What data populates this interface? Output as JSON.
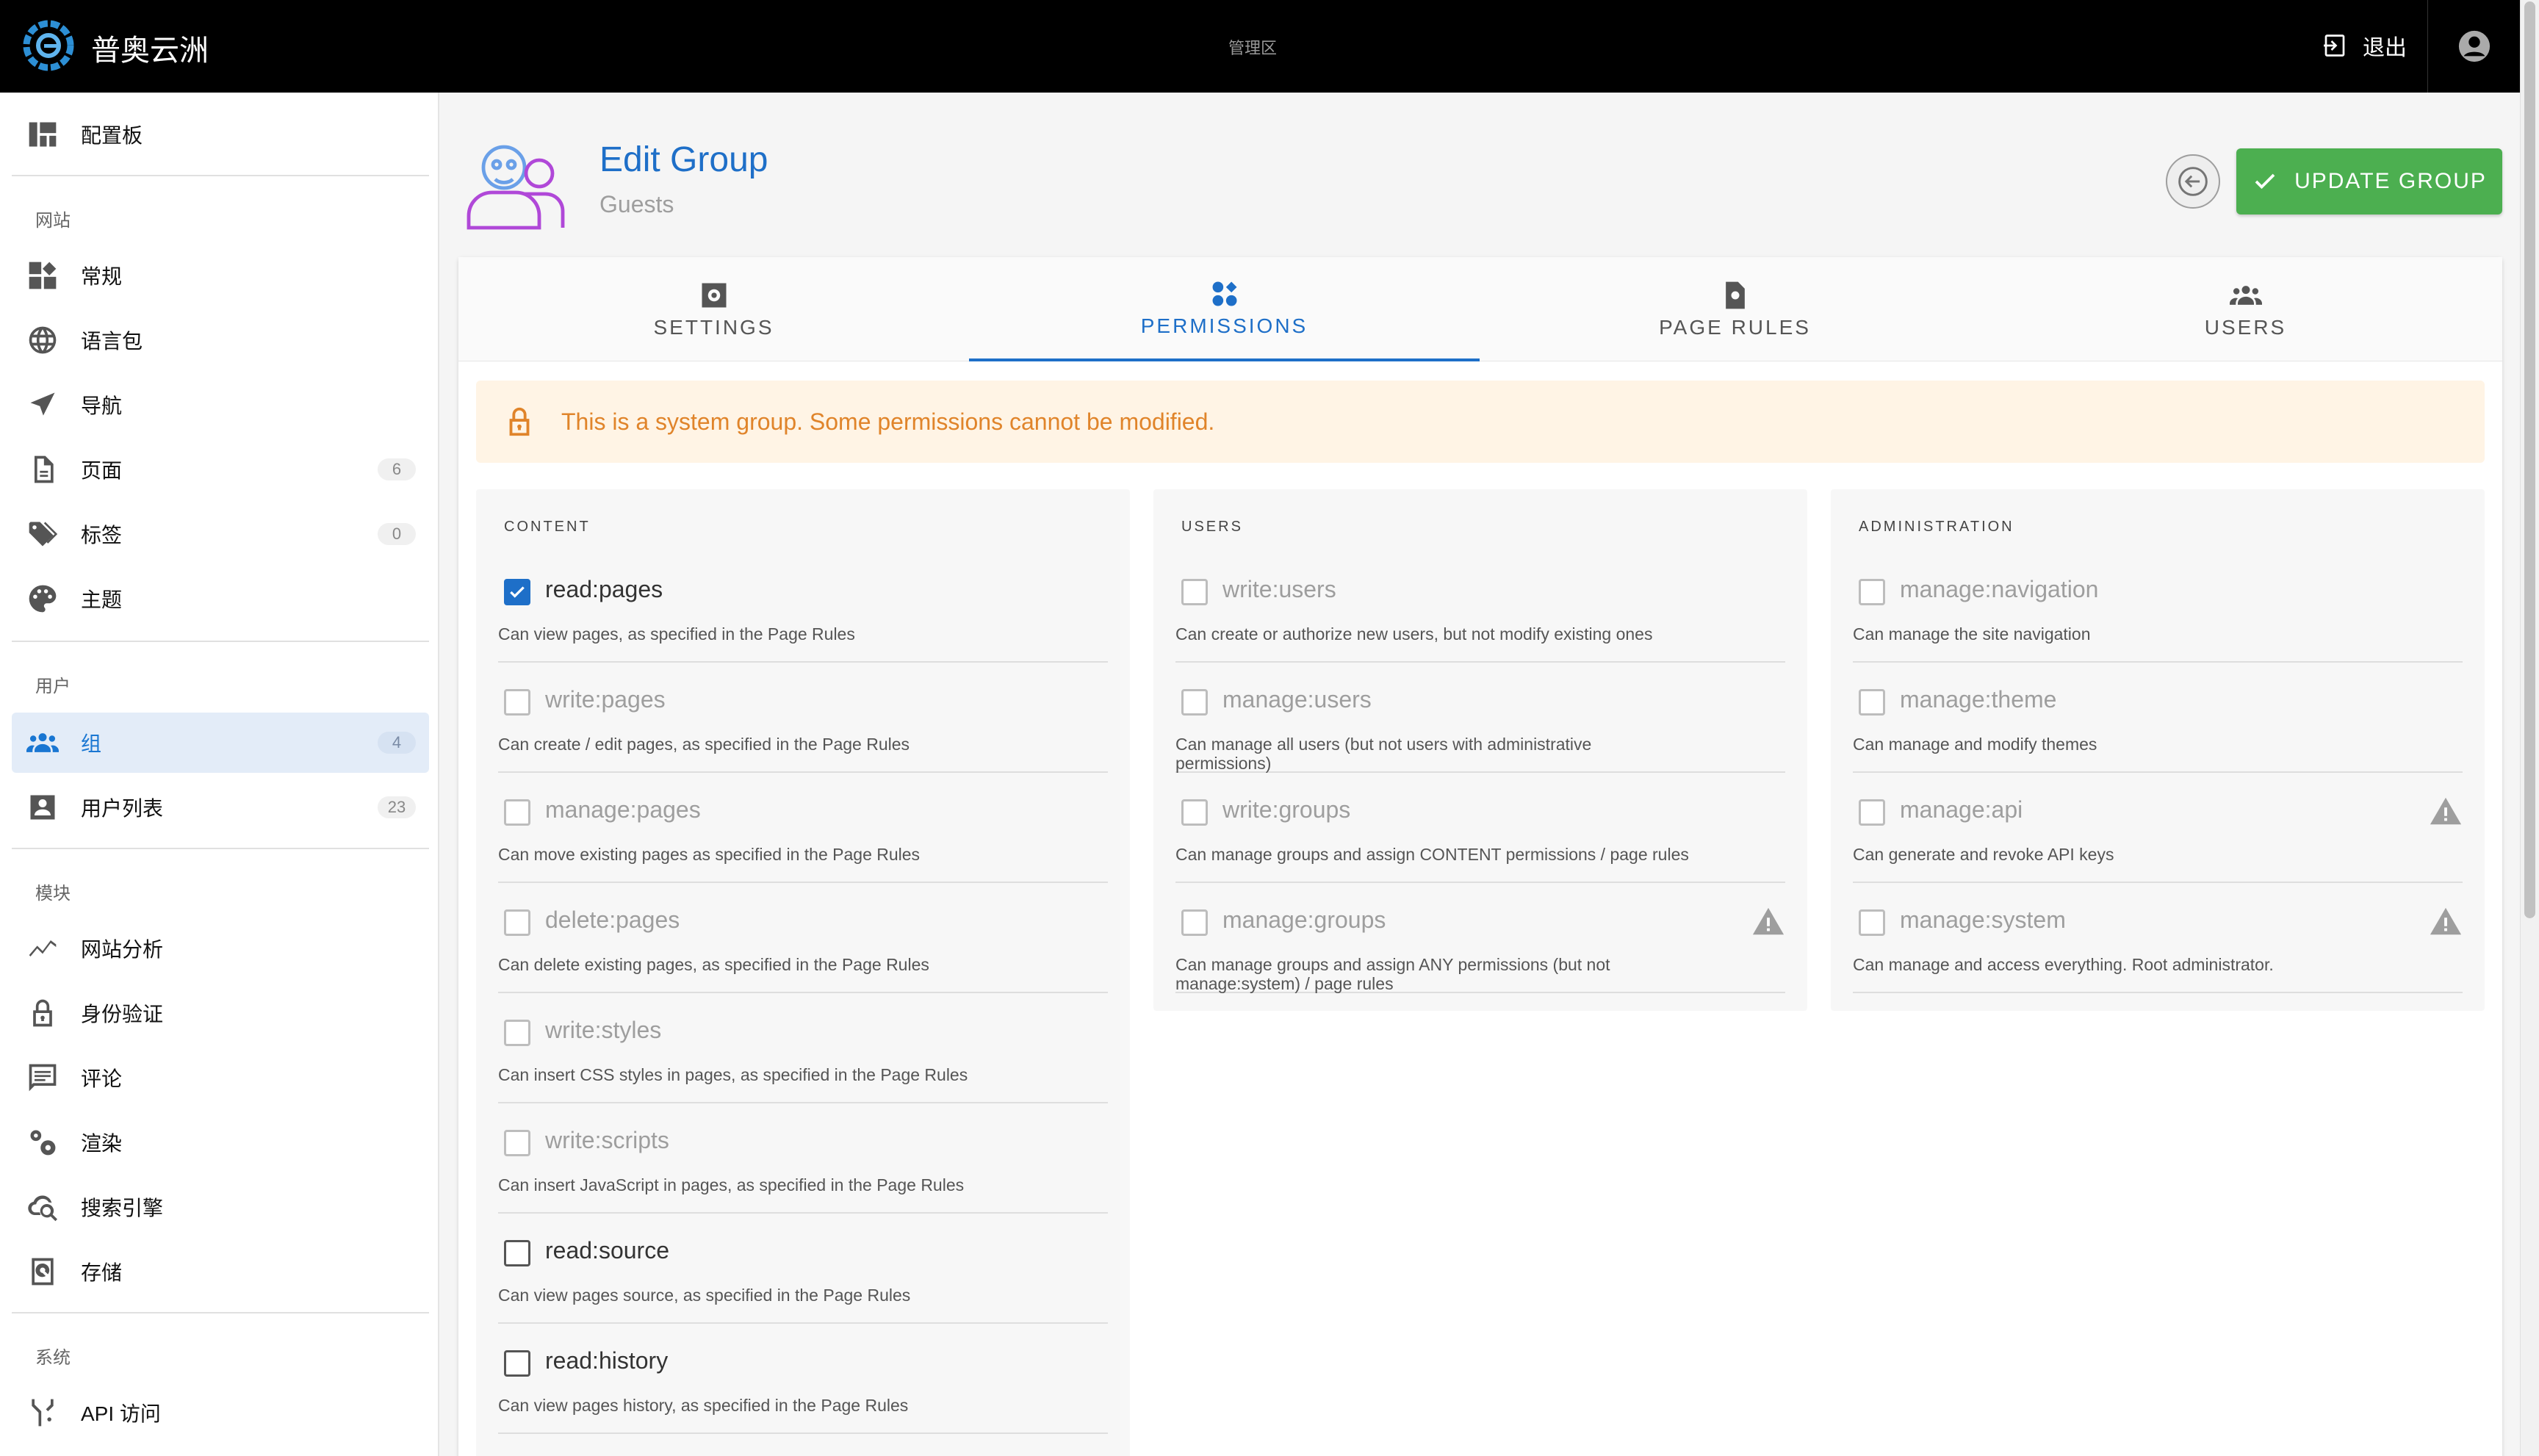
{
  "header": {
    "brand": "普奥云洲",
    "center_label": "管理区",
    "logout_label": "退出"
  },
  "sidebar": {
    "dashboard": "配置板",
    "sections": {
      "site": "网站",
      "users": "用户",
      "modules": "模块",
      "system": "系统"
    },
    "site_items": [
      {
        "label": "常规",
        "icon": "general-icon"
      },
      {
        "label": "语言包",
        "icon": "globe-icon"
      },
      {
        "label": "导航",
        "icon": "navigation-icon"
      },
      {
        "label": "页面",
        "icon": "page-icon",
        "count": "6"
      },
      {
        "label": "标签",
        "icon": "tag-icon",
        "count": "0"
      },
      {
        "label": "主题",
        "icon": "palette-icon"
      }
    ],
    "user_items": [
      {
        "label": "组",
        "icon": "group-icon",
        "count": "4"
      },
      {
        "label": "用户列表",
        "icon": "user-list-icon",
        "count": "23"
      }
    ],
    "module_items": [
      {
        "label": "网站分析",
        "icon": "analytics-icon"
      },
      {
        "label": "身份验证",
        "icon": "lock-icon"
      },
      {
        "label": "评论",
        "icon": "comment-icon"
      },
      {
        "label": "渲染",
        "icon": "gears-icon"
      },
      {
        "label": "搜索引擎",
        "icon": "search-cloud-icon"
      },
      {
        "label": "存储",
        "icon": "storage-icon"
      }
    ],
    "system_items": [
      {
        "label": "API 访问",
        "icon": "api-icon"
      }
    ]
  },
  "page": {
    "title": "Edit Group",
    "subtitle": "Guests",
    "update_label": "UPDATE GROUP"
  },
  "tabs": [
    {
      "label": "SETTINGS",
      "icon": "settings-icon"
    },
    {
      "label": "PERMISSIONS",
      "icon": "permissions-icon",
      "active": true
    },
    {
      "label": "PAGE RULES",
      "icon": "page-rules-icon"
    },
    {
      "label": "USERS",
      "icon": "users-icon"
    }
  ],
  "alert": {
    "text": "This is a system group. Some permissions cannot be modified.",
    "color": "#e0842a"
  },
  "columns": [
    {
      "title": "CONTENT",
      "permissions": [
        {
          "name": "read:pages",
          "desc": "Can view pages, as specified in the Page Rules",
          "checked": true,
          "enabled": true
        },
        {
          "name": "write:pages",
          "desc": "Can create / edit pages, as specified in the Page Rules",
          "checked": false,
          "enabled": false
        },
        {
          "name": "manage:pages",
          "desc": "Can move existing pages as specified in the Page Rules",
          "checked": false,
          "enabled": false
        },
        {
          "name": "delete:pages",
          "desc": "Can delete existing pages, as specified in the Page Rules",
          "checked": false,
          "enabled": false
        },
        {
          "name": "write:styles",
          "desc": "Can insert CSS styles in pages, as specified in the Page Rules",
          "checked": false,
          "enabled": false
        },
        {
          "name": "write:scripts",
          "desc": "Can insert JavaScript in pages, as specified in the Page Rules",
          "checked": false,
          "enabled": false
        },
        {
          "name": "read:source",
          "desc": "Can view pages source, as specified in the Page Rules",
          "checked": false,
          "enabled": true
        },
        {
          "name": "read:history",
          "desc": "Can view pages history, as specified in the Page Rules",
          "checked": false,
          "enabled": true
        }
      ]
    },
    {
      "title": "USERS",
      "permissions": [
        {
          "name": "write:users",
          "desc": "Can create or authorize new users, but not modify existing ones",
          "checked": false,
          "enabled": false
        },
        {
          "name": "manage:users",
          "desc": "Can manage all users (but not users with administrative permissions)",
          "checked": false,
          "enabled": false
        },
        {
          "name": "write:groups",
          "desc": "Can manage groups and assign CONTENT permissions / page rules",
          "checked": false,
          "enabled": false
        },
        {
          "name": "manage:groups",
          "desc": "Can manage groups and assign ANY permissions (but not manage:system) / page rules",
          "checked": false,
          "enabled": false,
          "warning": true
        }
      ]
    },
    {
      "title": "ADMINISTRATION",
      "permissions": [
        {
          "name": "manage:navigation",
          "desc": "Can manage the site navigation",
          "checked": false,
          "enabled": false
        },
        {
          "name": "manage:theme",
          "desc": "Can manage and modify themes",
          "checked": false,
          "enabled": false
        },
        {
          "name": "manage:api",
          "desc": "Can generate and revoke API keys",
          "checked": false,
          "enabled": false,
          "warning": true
        },
        {
          "name": "manage:system",
          "desc": "Can manage and access everything. Root administrator.",
          "checked": false,
          "enabled": false,
          "warning": true
        }
      ]
    }
  ]
}
